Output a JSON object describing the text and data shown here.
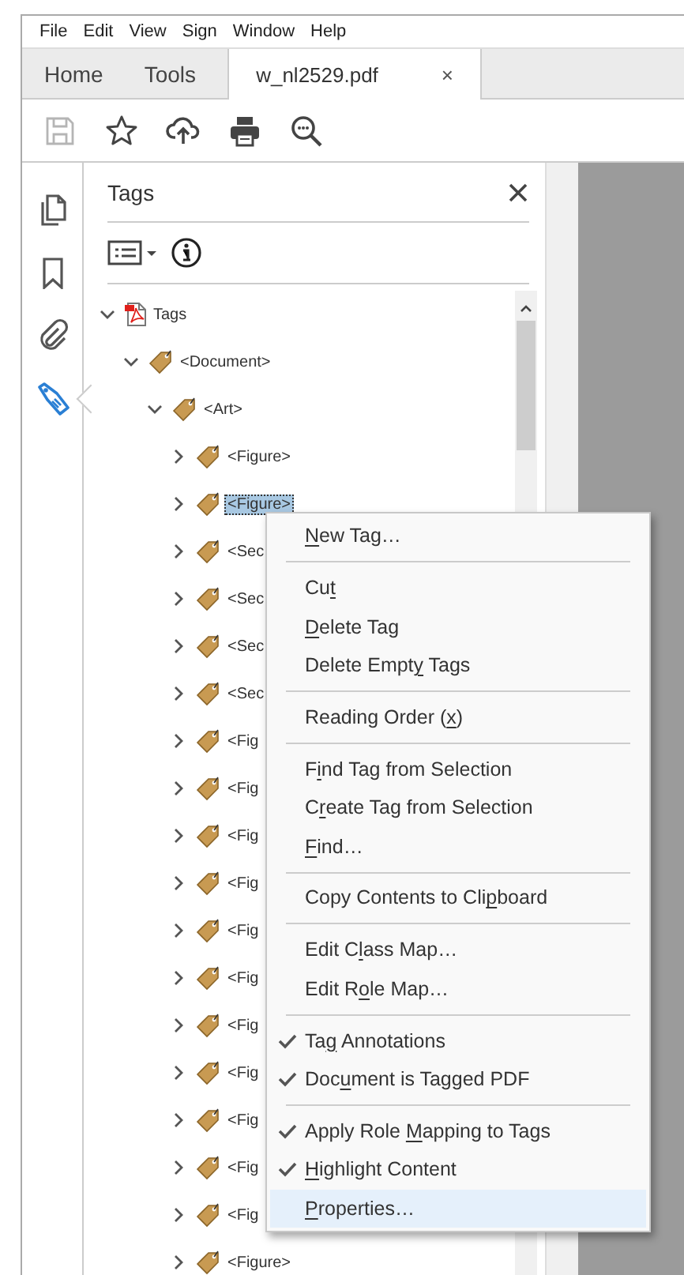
{
  "menubar": [
    "File",
    "Edit",
    "View",
    "Sign",
    "Window",
    "Help"
  ],
  "tabs": [
    {
      "label": "Home",
      "kind": "nav",
      "selected": false
    },
    {
      "label": "Tools",
      "kind": "nav",
      "selected": false
    },
    {
      "label": "w_nl2529.pdf",
      "kind": "document",
      "selected": true,
      "close": "×"
    }
  ],
  "toolbar": [
    {
      "kind": "save",
      "disabled": true
    },
    {
      "kind": "bookmark",
      "disabled": false
    },
    {
      "kind": "upload",
      "disabled": false
    },
    {
      "kind": "print",
      "disabled": false
    },
    {
      "kind": "zoom",
      "disabled": false
    }
  ],
  "rail": [
    {
      "kind": "pages",
      "selected": false
    },
    {
      "kind": "bookmarks",
      "selected": false
    },
    {
      "kind": "attachments",
      "selected": false
    },
    {
      "kind": "tags",
      "selected": true
    }
  ],
  "panel": {
    "title": "Tags"
  },
  "tree": [
    {
      "label": "Tags",
      "kind": "root",
      "expanded": true,
      "selected": false,
      "children": [
        {
          "label": "<Document>",
          "kind": "tag",
          "expanded": true,
          "selected": false,
          "children": [
            {
              "label": "<Art>",
              "kind": "tag",
              "expanded": true,
              "selected": false,
              "children": [
                {
                  "label": "<Figure>",
                  "kind": "tag",
                  "expanded": false,
                  "selected": false
                },
                {
                  "label": "<Figure>",
                  "kind": "tag",
                  "expanded": false,
                  "selected": true
                },
                {
                  "label": "<Sec",
                  "kind": "tag",
                  "expanded": false,
                  "selected": false
                },
                {
                  "label": "<Sec",
                  "kind": "tag",
                  "expanded": false,
                  "selected": false
                },
                {
                  "label": "<Sec",
                  "kind": "tag",
                  "expanded": false,
                  "selected": false
                },
                {
                  "label": "<Sec",
                  "kind": "tag",
                  "expanded": false,
                  "selected": false
                },
                {
                  "label": "<Fig",
                  "kind": "tag",
                  "expanded": false,
                  "selected": false
                },
                {
                  "label": "<Fig",
                  "kind": "tag",
                  "expanded": false,
                  "selected": false
                },
                {
                  "label": "<Fig",
                  "kind": "tag",
                  "expanded": false,
                  "selected": false
                },
                {
                  "label": "<Fig",
                  "kind": "tag",
                  "expanded": false,
                  "selected": false
                },
                {
                  "label": "<Fig",
                  "kind": "tag",
                  "expanded": false,
                  "selected": false
                },
                {
                  "label": "<Fig",
                  "kind": "tag",
                  "expanded": false,
                  "selected": false
                },
                {
                  "label": "<Fig",
                  "kind": "tag",
                  "expanded": false,
                  "selected": false
                },
                {
                  "label": "<Fig",
                  "kind": "tag",
                  "expanded": false,
                  "selected": false
                },
                {
                  "label": "<Fig",
                  "kind": "tag",
                  "expanded": false,
                  "selected": false
                },
                {
                  "label": "<Fig",
                  "kind": "tag",
                  "expanded": false,
                  "selected": false
                },
                {
                  "label": "<Fig",
                  "kind": "tag",
                  "expanded": false,
                  "selected": false
                },
                {
                  "label": "<Figure>",
                  "kind": "tag",
                  "expanded": false,
                  "selected": false
                }
              ]
            }
          ]
        }
      ]
    }
  ],
  "context_menu": [
    {
      "kind": "item",
      "label": {
        "key": "N",
        "after": "ew Tag…"
      },
      "checked": false,
      "selected": false
    },
    {
      "kind": "separator"
    },
    {
      "kind": "item",
      "label": {
        "before": "Cu",
        "key": "t"
      },
      "checked": false,
      "selected": false
    },
    {
      "kind": "item",
      "label": {
        "key": "D",
        "after": "elete Tag"
      },
      "checked": false,
      "selected": false
    },
    {
      "kind": "item",
      "label": {
        "before": "Delete Empt",
        "key": "y",
        "after": " Tags"
      },
      "checked": false,
      "selected": false
    },
    {
      "kind": "separator"
    },
    {
      "kind": "item",
      "label": {
        "before": "Reading Order (",
        "key": "x",
        "after": ")"
      },
      "checked": false,
      "selected": false
    },
    {
      "kind": "separator"
    },
    {
      "kind": "item",
      "label": {
        "before": "F",
        "key": "i",
        "after": "nd Tag from Selection"
      },
      "checked": false,
      "selected": false
    },
    {
      "kind": "item",
      "label": {
        "before": "C",
        "key": "r",
        "after": "eate Tag from Selection"
      },
      "checked": false,
      "selected": false
    },
    {
      "kind": "item",
      "label": {
        "key": "F",
        "after": "ind…"
      },
      "checked": false,
      "selected": false
    },
    {
      "kind": "separator"
    },
    {
      "kind": "item",
      "label": {
        "before": "Copy Contents to Cli",
        "key": "p",
        "after": "board"
      },
      "checked": false,
      "selected": false
    },
    {
      "kind": "separator"
    },
    {
      "kind": "item",
      "label": {
        "before": "Edit C",
        "key": "l",
        "after": "ass Map…"
      },
      "checked": false,
      "selected": false
    },
    {
      "kind": "item",
      "label": {
        "before": "Edit R",
        "key": "o",
        "after": "le Map…"
      },
      "checked": false,
      "selected": false
    },
    {
      "kind": "separator"
    },
    {
      "kind": "item",
      "label": {
        "before": "Ta",
        "key": "g",
        "after": " Annotations"
      },
      "checked": true,
      "selected": false
    },
    {
      "kind": "item",
      "label": {
        "before": "Doc",
        "key": "u",
        "after": "ment is Tagged PDF"
      },
      "checked": true,
      "selected": false
    },
    {
      "kind": "separator"
    },
    {
      "kind": "item",
      "label": {
        "before": "Apply Role ",
        "key": "M",
        "after": "apping to Tags"
      },
      "checked": true,
      "selected": false
    },
    {
      "kind": "item",
      "label": {
        "key": "H",
        "after": "ighlight Content"
      },
      "checked": true,
      "selected": false
    },
    {
      "kind": "item",
      "label": {
        "key": "P",
        "after": "roperties…"
      },
      "checked": false,
      "selected": true
    }
  ]
}
